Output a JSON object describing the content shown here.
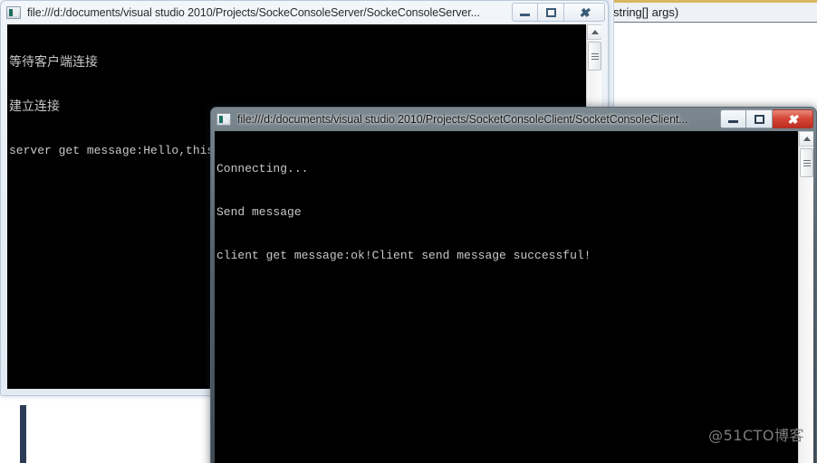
{
  "background": {
    "editor": {
      "code_fragment": "string[] args)"
    }
  },
  "server_window": {
    "title": "file:///d:/documents/visual studio 2010/Projects/SockeConsoleServer/SockeConsoleServer...",
    "state": "inactive",
    "icon": "console-app-icon",
    "buttons": {
      "minimize": "Minimize",
      "maximize": "Maximize",
      "close": "Close"
    },
    "console_lines": [
      "等待客户端连接",
      "建立连接",
      "server get message:Hello,this is a socket test"
    ],
    "scrollbar": {
      "up_arrow": "scroll-up",
      "thumb": "scroll-thumb"
    }
  },
  "client_window": {
    "title": "file:///d:/documents/visual studio 2010/Projects/SocketConsoleClient/SocketConsoleClient...",
    "state": "active",
    "icon": "console-app-icon",
    "buttons": {
      "minimize": "Minimize",
      "maximize": "Maximize",
      "close": "Close"
    },
    "console_lines": [
      "Connecting...",
      "Send message",
      "client get message:ok!Client send message successful!"
    ],
    "scrollbar": {
      "up_arrow": "scroll-up",
      "thumb": "scroll-thumb"
    }
  },
  "watermark": {
    "text": "@51CTO博客"
  },
  "colors": {
    "console_bg": "#000000",
    "console_fg": "#c8c8c8",
    "active_close": "#d8483a",
    "editor_accent": "#d8b860"
  }
}
